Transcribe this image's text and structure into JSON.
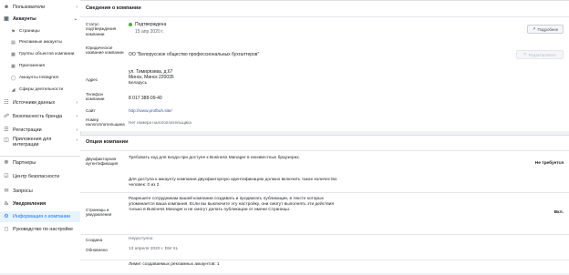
{
  "sidebar": {
    "items": [
      {
        "label": "Пользователи",
        "icon": "users-icon"
      },
      {
        "label": "Аккаунты",
        "icon": "accounts-icon"
      },
      {
        "label": "Страницы",
        "icon": "flag-icon"
      },
      {
        "label": "Рекламные аккаунты",
        "icon": "ad-account-icon"
      },
      {
        "label": "Группы объектов компании",
        "icon": "asset-groups-icon"
      },
      {
        "label": "Приложения",
        "icon": "apps-icon"
      },
      {
        "label": "Аккаунты Instagram",
        "icon": "instagram-icon"
      },
      {
        "label": "Сферы деятельности",
        "icon": "lines-of-business-icon"
      },
      {
        "label": "Источники данных",
        "icon": "data-sources-icon"
      },
      {
        "label": "Безопасность бренда",
        "icon": "brand-safety-icon"
      },
      {
        "label": "Регистрации",
        "icon": "registrations-icon"
      },
      {
        "label": "Приложения для интеграции",
        "icon": "integrations-icon"
      },
      {
        "label": "Партнеры",
        "icon": "partners-icon"
      },
      {
        "label": "Центр безопасности",
        "icon": "security-center-icon"
      },
      {
        "label": "Запросы",
        "icon": "requests-icon"
      },
      {
        "label": "Уведомления",
        "icon": "notifications-icon"
      },
      {
        "label": "Информация о компании",
        "icon": "business-info-icon"
      },
      {
        "label": "Руководство по настройке",
        "icon": "setup-guide-icon"
      }
    ]
  },
  "company_info": {
    "title": "Сведения о компании",
    "status_label": "Статус подтверждения компании",
    "status_value": "Подтверждена",
    "status_date": "15 апр 2020 г.",
    "details_button": "Подробнее",
    "legal_name_label": "Юридическое название компании",
    "legal_name_value": "ОО \"Белорусское общество профессиональных бухгалтеров\"",
    "edit_button": "Редактировать",
    "address_label": "Адрес",
    "address_line1": "ул. Тимирязева, д.67",
    "address_line2": "Минск, Минск 220035",
    "address_line3": "Беларусь",
    "phone_label": "Телефон компании",
    "phone_value": "8 017 388-09-40",
    "site_label": "Сайт",
    "site_value": "http://www.profbuh.site/",
    "tax_label": "Номер налогоплательщика",
    "tax_value": "Нет номера налогоплательщика"
  },
  "options": {
    "title": "Опции компании",
    "two_factor_label": "Двухфакторная аутентификация",
    "two_factor_text1": "Требовать код для входа при доступе к Business Manager в неизвестных браузерах.",
    "two_factor_value": "Не требуется",
    "two_factor_text2": "Для доступа к аккаунту компании двухфакторную идентификацию должно включить такое количество человек: 0 из 2.",
    "pages_label": "Страницы и уведомления",
    "pages_text": "Разрешите сотрудникам вашей компании создавать и продвигать публикации, в тексте которых упоминается ваша компания. Если вы выключите эту настройку, они смогут выполнять эти действия только в Business Manager и не смогут делать публикации от имени Страницы.",
    "pages_text_full": "Разрешите сотрудникам вашей компании создавать и продвигать публикации, в тексте которых упоминается ваша компания. Если вы выключите эту настройку, они смогут выполнять эти действия только в Business Manager и не смогут делать публикации от имени Страницы.",
    "pages_value": "Вкл.",
    "created_label": "Создана",
    "created_value": "Недоступно",
    "updated_label": "Обновлено",
    "updated_value": "13 апреля 2020 г. DM XL",
    "limit_text": "Лимит создаваемых рекламных аккаунтов: 1"
  },
  "colors": {
    "accent": "#1877f2",
    "status_green": "#42b72a",
    "link": "#385898"
  }
}
